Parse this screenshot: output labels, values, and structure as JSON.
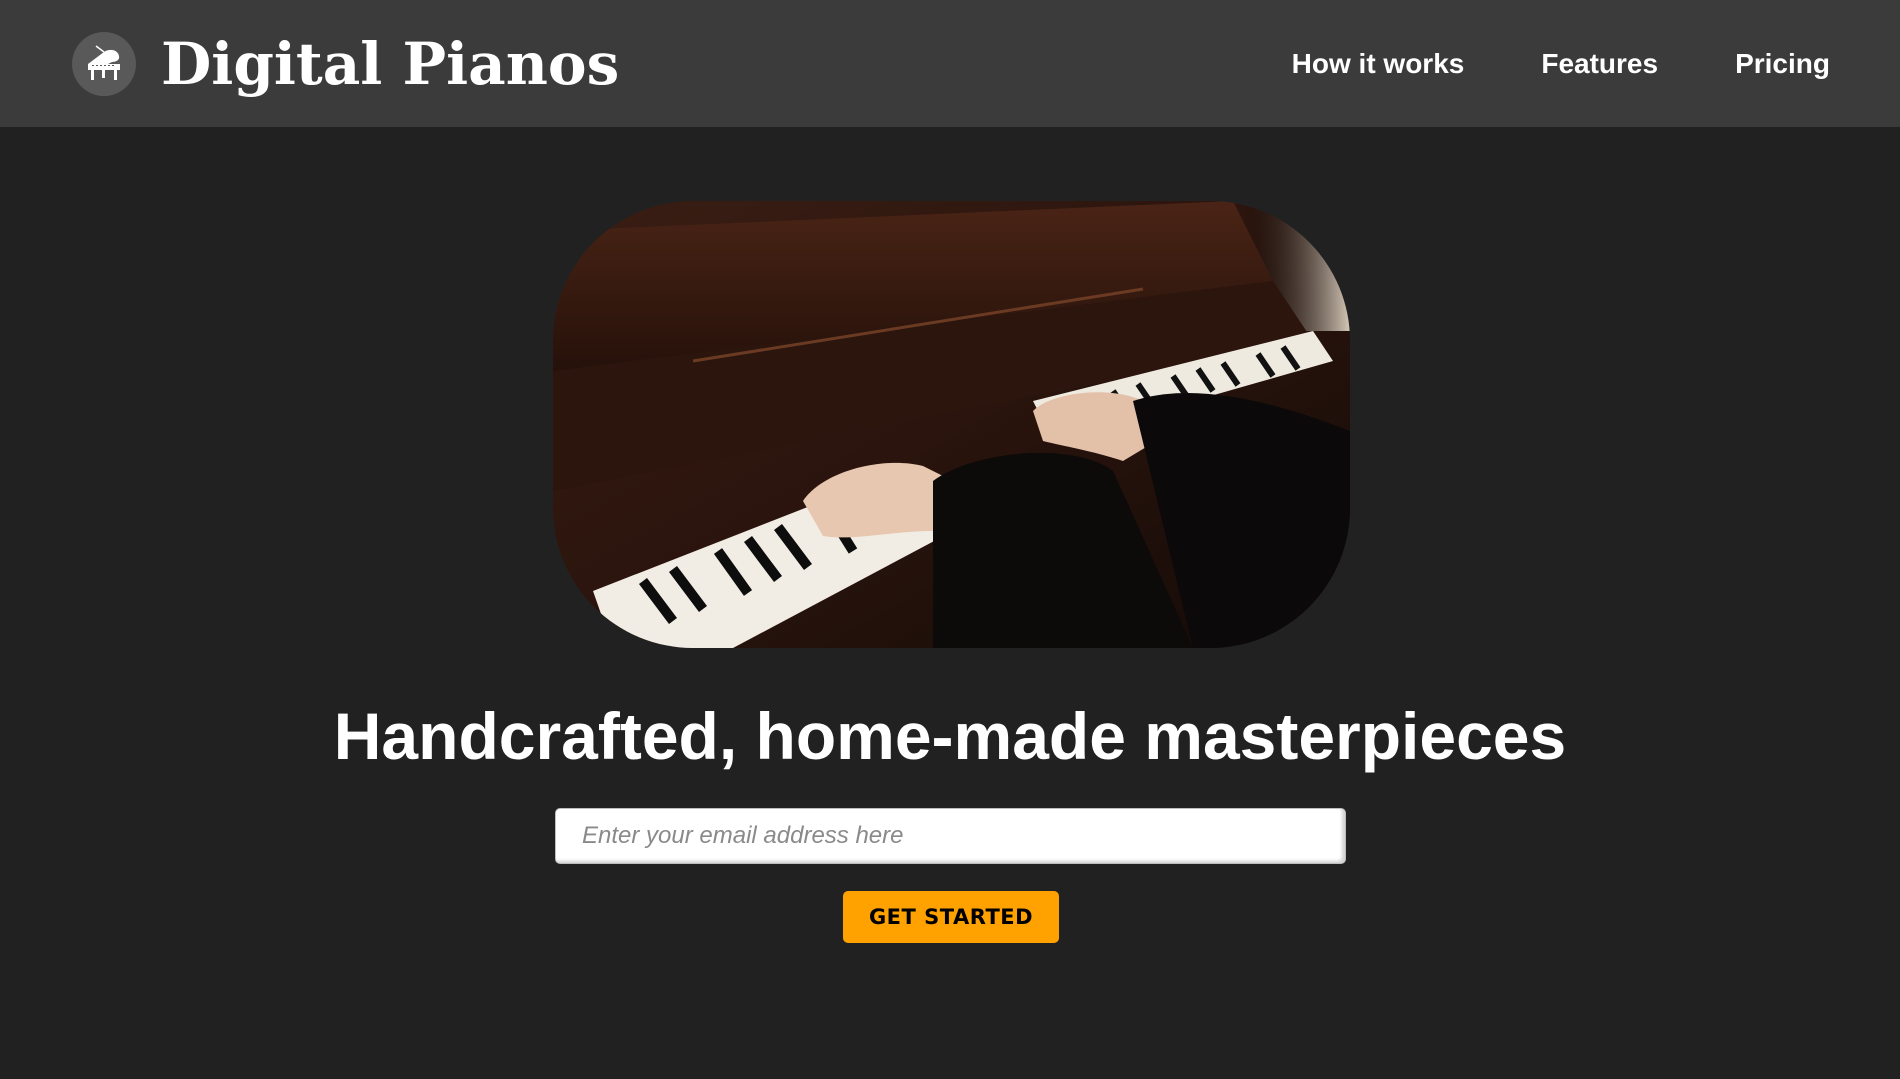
{
  "header": {
    "brand": "Digital Pianos",
    "logo_icon": "grand-piano-icon",
    "nav": [
      {
        "label": "How it works"
      },
      {
        "label": "Features"
      },
      {
        "label": "Pricing"
      }
    ]
  },
  "hero": {
    "image_icon": "piano-hands-photo",
    "headline": "Handcrafted, home-made masterpieces",
    "email_placeholder": "Enter your email address here",
    "cta_label": "GET STARTED"
  },
  "colors": {
    "page_bg": "#212121",
    "header_bg": "#3b3b3b",
    "accent": "#ffa200"
  }
}
